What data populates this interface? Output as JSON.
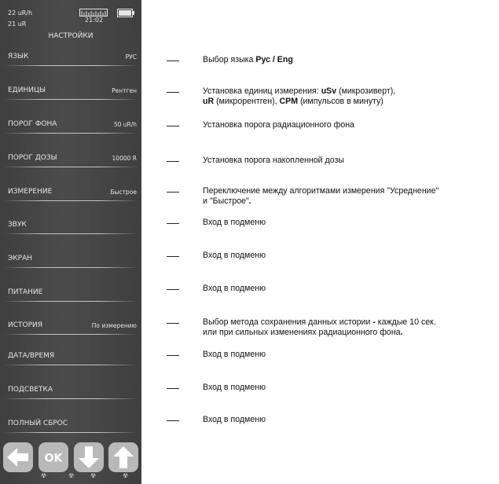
{
  "status": {
    "current_rate": "22 uR/h",
    "accumulated": "21 uR",
    "time": "21:02",
    "title": "НАСТРОЙКИ"
  },
  "menu": [
    {
      "label": "ЯЗЫК",
      "value": "РУС"
    },
    {
      "label": "ЕДИНИЦЫ",
      "value": "Рентген"
    },
    {
      "label": "ПОРОГ ФОНА",
      "value": "50 uR/h"
    },
    {
      "label": "ПОРОГ ДОЗЫ",
      "value": "10000 R"
    },
    {
      "label": "ИЗМЕРЕНИЕ",
      "value": "Быстрое"
    },
    {
      "label": "ЗВУК",
      "value": ""
    },
    {
      "label": "ЭКРАН",
      "value": ""
    },
    {
      "label": "ПИТАНИЕ",
      "value": ""
    },
    {
      "label": "ИСТОРИЯ",
      "value": "По измерению"
    },
    {
      "label": "ДАТА/ВРЕМЯ",
      "value": ""
    },
    {
      "label": "ПОДСВЕТКА",
      "value": ""
    },
    {
      "label": "ПОЛНЫЙ СБРОС",
      "value": ""
    }
  ],
  "buttons": {
    "back_icon": "arrow-left-icon",
    "ok_label": "OK",
    "down_icon": "arrow-down-icon",
    "up_icon": "arrow-up-icon"
  },
  "descriptions": [
    {
      "parts": [
        {
          "t": "Выбор языка "
        },
        {
          "t": "Рус / Eng",
          "b": true
        }
      ]
    },
    {
      "parts": [
        {
          "t": "Установка единиц измерения: "
        },
        {
          "t": "uSv",
          "b": true
        },
        {
          "t": " (микрозиверт),"
        }
      ],
      "line2": [
        {
          "t": "uR",
          "b": true
        },
        {
          "t": " (микрорентген), "
        },
        {
          "t": "CPM",
          "b": true
        },
        {
          "t": " (импульсов в минуту)"
        }
      ]
    },
    {
      "parts": [
        {
          "t": "Установка порога радиационного фона"
        }
      ]
    },
    {
      "parts": [
        {
          "t": "Установка порога накопленной дозы"
        }
      ]
    },
    {
      "parts": [
        {
          "t": "Переключение между алгоритмами измерения \"Усреднение\""
        }
      ],
      "line2": [
        {
          "t": "и \"Быстрое\""
        },
        {
          "t": ".",
          "b": true
        }
      ]
    },
    {
      "parts": [
        {
          "t": "Вход в подменю"
        }
      ]
    },
    {
      "parts": [
        {
          "t": "Вход в подменю"
        }
      ]
    },
    {
      "parts": [
        {
          "t": "Вход в подменю"
        }
      ]
    },
    {
      "parts": [
        {
          "t": "Выбор метода сохранения данных истории "
        },
        {
          "t": "-",
          "b": true
        },
        {
          "t": " каждые 10 сек."
        }
      ],
      "line2": [
        {
          "t": "или при сильных изменениях радиационного фона"
        },
        {
          "t": ".",
          "b": true
        }
      ]
    },
    {
      "parts": [
        {
          "t": "Вход в подменю"
        }
      ]
    },
    {
      "parts": [
        {
          "t": "Вход в подменю"
        }
      ]
    },
    {
      "parts": [
        {
          "t": "Вход в подменю"
        }
      ]
    }
  ],
  "colors": {
    "screen": "#444444",
    "button": "#b9b9b9",
    "button_icon": "#ffffff"
  }
}
